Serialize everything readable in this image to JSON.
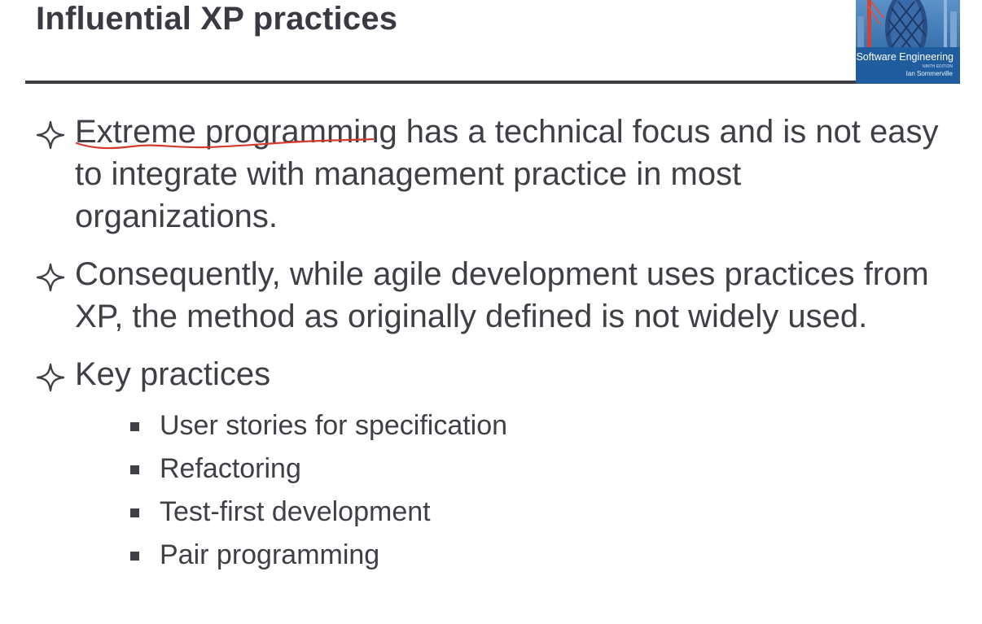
{
  "slide": {
    "title": "Influential XP practices"
  },
  "book_cover": {
    "title": "Software Engineering",
    "edition": "NINTH EDITION",
    "author": "Ian Sommerville"
  },
  "bullets": [
    {
      "text": "Extreme programming has a technical focus and is not easy to integrate with management practice in most organizations."
    },
    {
      "text": "Consequently, while agile development uses practices from XP, the method as originally defined is not widely used."
    },
    {
      "text": "Key practices"
    }
  ],
  "sub_bullets": [
    {
      "text": "User stories for specification"
    },
    {
      "text": "Refactoring"
    },
    {
      "text": "Test-first development"
    },
    {
      "text": "Pair programming"
    }
  ],
  "annotation": {
    "color": "#d33a2c"
  }
}
